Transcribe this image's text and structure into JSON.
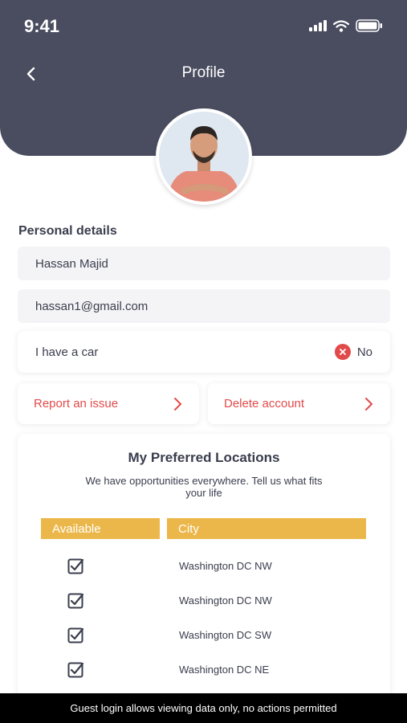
{
  "status_bar": {
    "time": "9:41",
    "icons": [
      "signal-icon",
      "wifi-icon",
      "battery-icon"
    ]
  },
  "header": {
    "title": "Profile",
    "back_icon": "chevron-left-icon"
  },
  "personal_details": {
    "title": "Personal details",
    "name": "Hassan Majid",
    "email": "hassan1@gmail.com",
    "car": {
      "label": "I have a car",
      "value": "No",
      "icon": "x-circle-icon"
    }
  },
  "actions": {
    "report_issue": "Report an issue",
    "delete_account": "Delete account"
  },
  "locations": {
    "title": "My Preferred Locations",
    "subtitle": "We have opportunities everywhere. Tell us what fits your life",
    "columns": [
      "Available",
      "City"
    ],
    "rows": [
      {
        "available": true,
        "city": "Washington DC NW"
      },
      {
        "available": true,
        "city": "Washington DC NW"
      },
      {
        "available": true,
        "city": "Washington DC SW"
      },
      {
        "available": true,
        "city": "Washington DC NE"
      }
    ]
  },
  "footer": {
    "text": "Guest login allows viewing data only, no actions permitted"
  },
  "colors": {
    "header_bg": "#4a4d60",
    "accent": "#ecb74a",
    "danger": "#e24a4a",
    "text": "#3a3d4d"
  }
}
